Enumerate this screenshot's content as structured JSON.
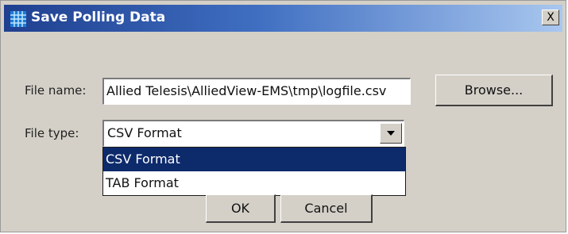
{
  "window": {
    "title": "Save Polling Data",
    "close_label": "X"
  },
  "form": {
    "file_name_label": "File name:",
    "file_name_value": "Allied Telesis\\AlliedView-EMS\\tmp\\logfile.csv",
    "file_type_label": "File type:",
    "file_type_value": "CSV Format",
    "file_type_options": [
      "CSV Format",
      "TAB Format"
    ]
  },
  "buttons": {
    "browse": "Browse...",
    "ok": "OK",
    "cancel": "Cancel"
  },
  "colors": {
    "selection": "#0d2a6b",
    "titlebar_start": "#1f3f8f",
    "titlebar_end": "#a9c7ef"
  },
  "icons": {
    "app": "grid-icon",
    "close": "close-icon",
    "dropdown": "chevron-down-icon"
  }
}
